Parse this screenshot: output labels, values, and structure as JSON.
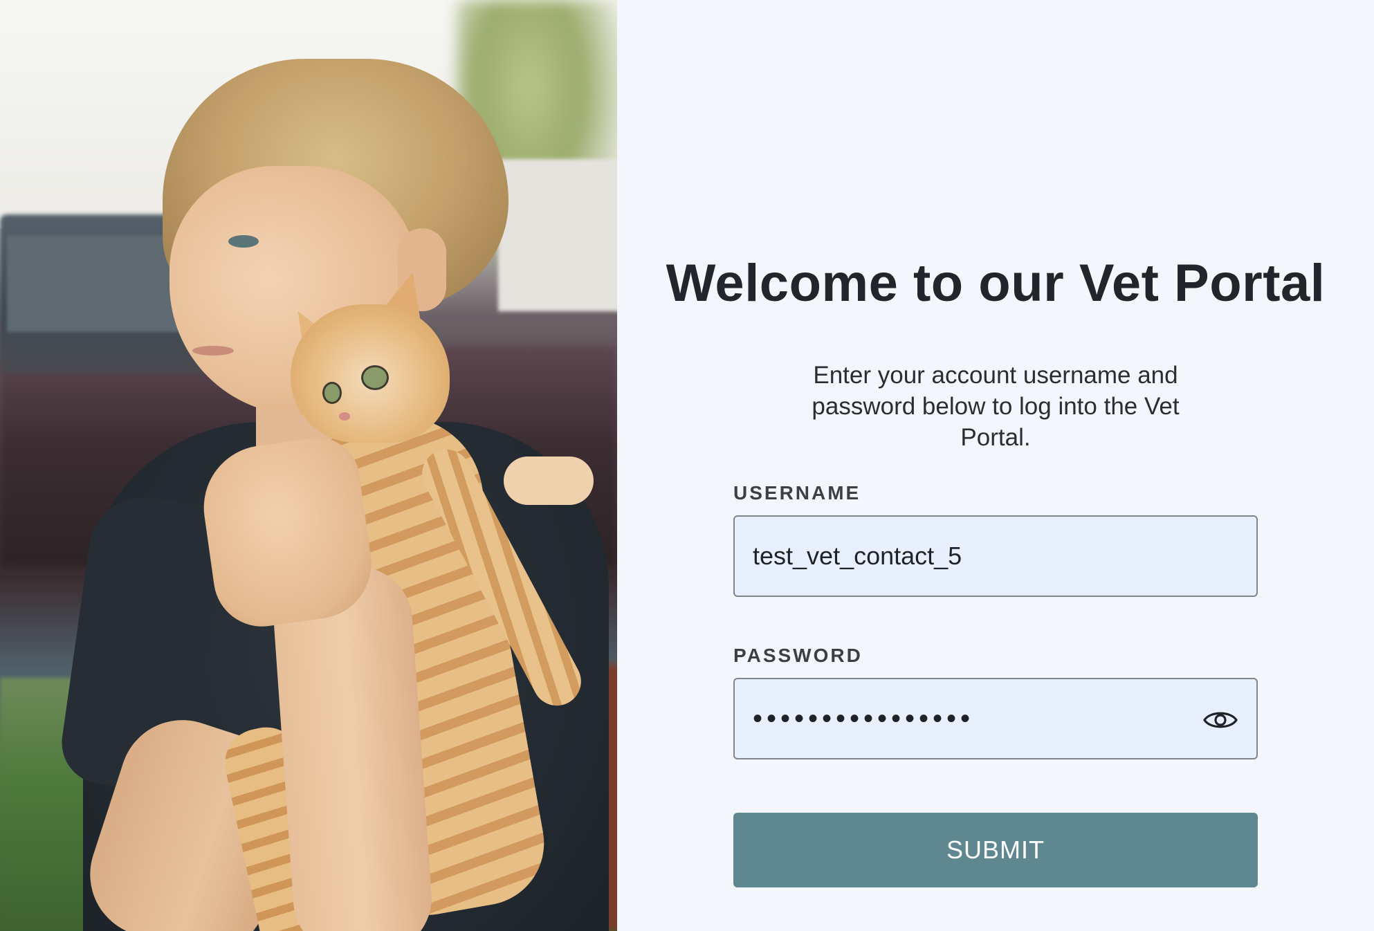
{
  "hero": {
    "image_description_icon": "boy-holding-kitten-photo"
  },
  "login": {
    "title": "Welcome to our Vet Portal",
    "subtitle": "Enter your account username and password below to log into the Vet Portal.",
    "username_label": "USERNAME",
    "username_value": "test_vet_contact_5",
    "password_label": "PASSWORD",
    "password_value": "••••••••••••••••",
    "password_toggle_icon": "eye-icon",
    "submit_label": "SUBMIT"
  },
  "colors": {
    "panel_background": "#f3f6fa",
    "field_background": "#e8f0fe",
    "field_border": "#7e858c",
    "submit_background": "#5e8790",
    "submit_text": "#ffffff",
    "title_text": "#22252a"
  }
}
